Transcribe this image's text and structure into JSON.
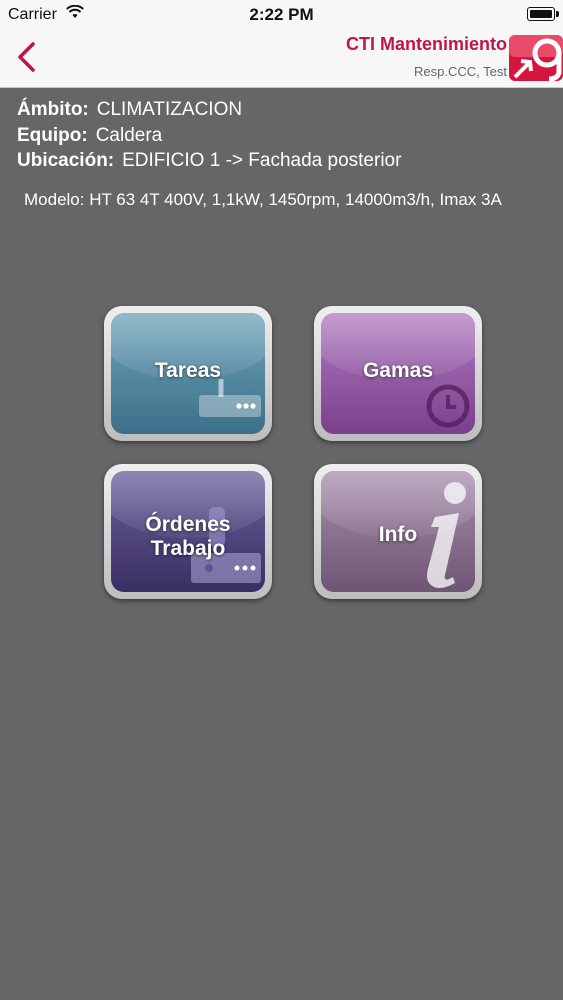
{
  "status_bar": {
    "carrier": "Carrier",
    "time": "2:22 PM"
  },
  "header": {
    "app_title": "CTI Mantenimiento",
    "subtitle": "Resp.CCC, Test"
  },
  "details": {
    "ambito_label": "Ámbito:",
    "ambito_value": "CLIMATIZACION",
    "equipo_label": "Equipo:",
    "equipo_value": "Caldera",
    "ubicacion_label": "Ubicación:",
    "ubicacion_value": "EDIFICIO 1 -> Fachada posterior",
    "modelo": "Modelo: HT 63 4T 400V, 1,1kW, 1450rpm, 14000m3/h, Imax 3A"
  },
  "menu": {
    "tareas": "Tareas",
    "gamas": "Gamas",
    "ordenes_line1": "Órdenes",
    "ordenes_line2": "Trabajo",
    "info": "Info"
  },
  "colors": {
    "accent": "#c0154b",
    "background": "#666567"
  }
}
